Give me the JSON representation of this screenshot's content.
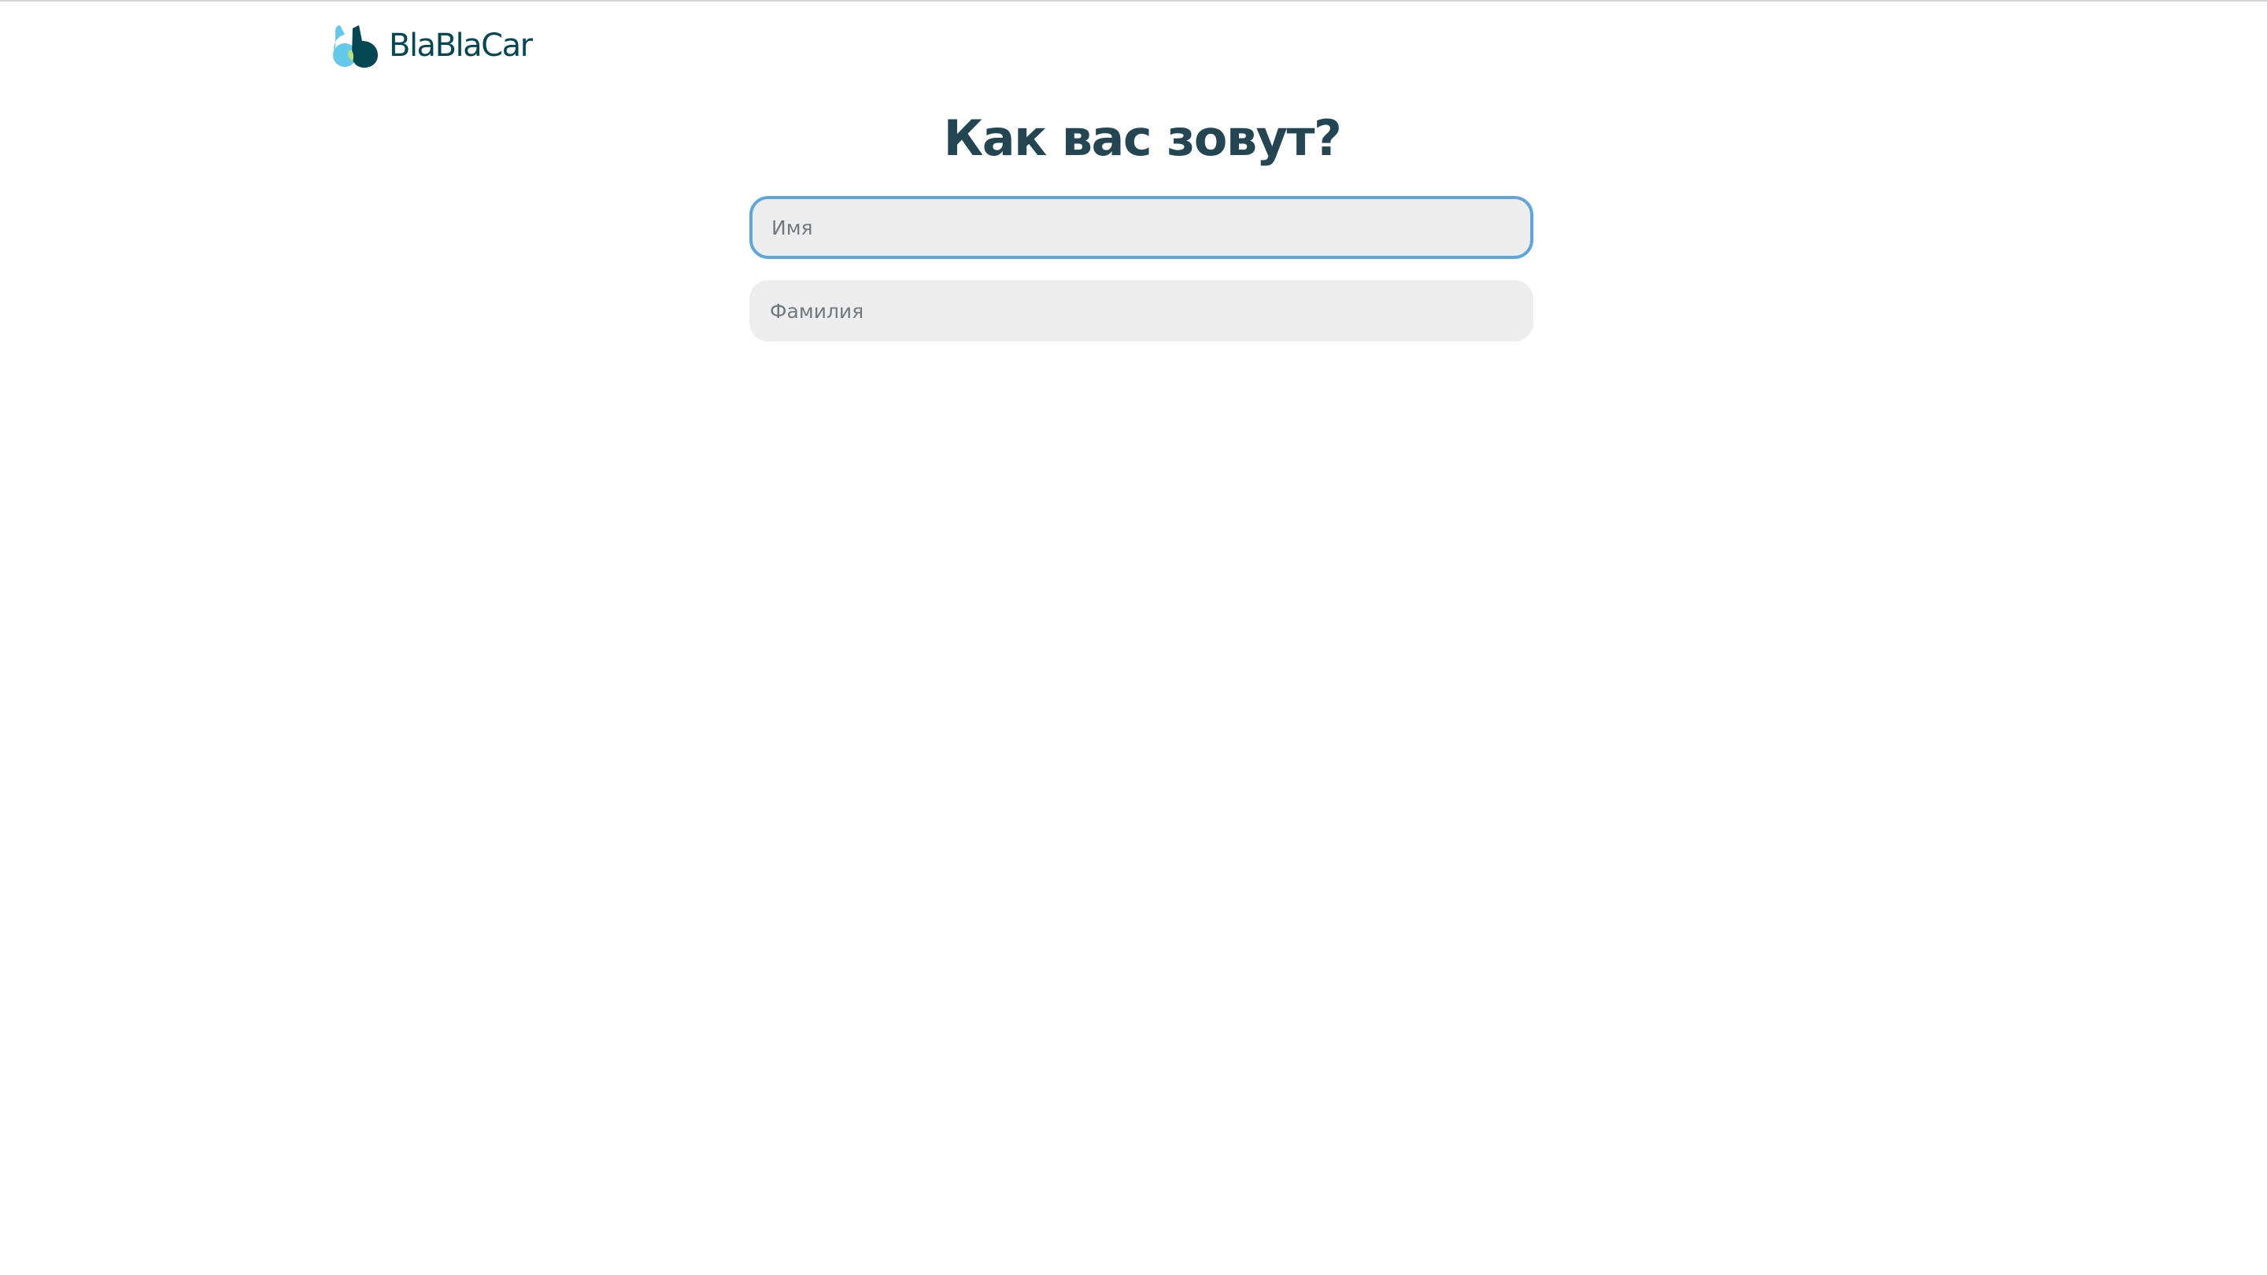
{
  "brand": {
    "name": "BlaBlaCar",
    "colors": {
      "primary_dark": "#054752",
      "accent_blue": "#64c8eb",
      "accent_green": "#b8e07a",
      "focus_ring": "#5ea7dc",
      "field_bg": "#ededed"
    }
  },
  "form": {
    "title": "Как вас зовут?",
    "first_name": {
      "placeholder": "Имя",
      "value": ""
    },
    "last_name": {
      "placeholder": "Фамилия",
      "value": ""
    }
  }
}
